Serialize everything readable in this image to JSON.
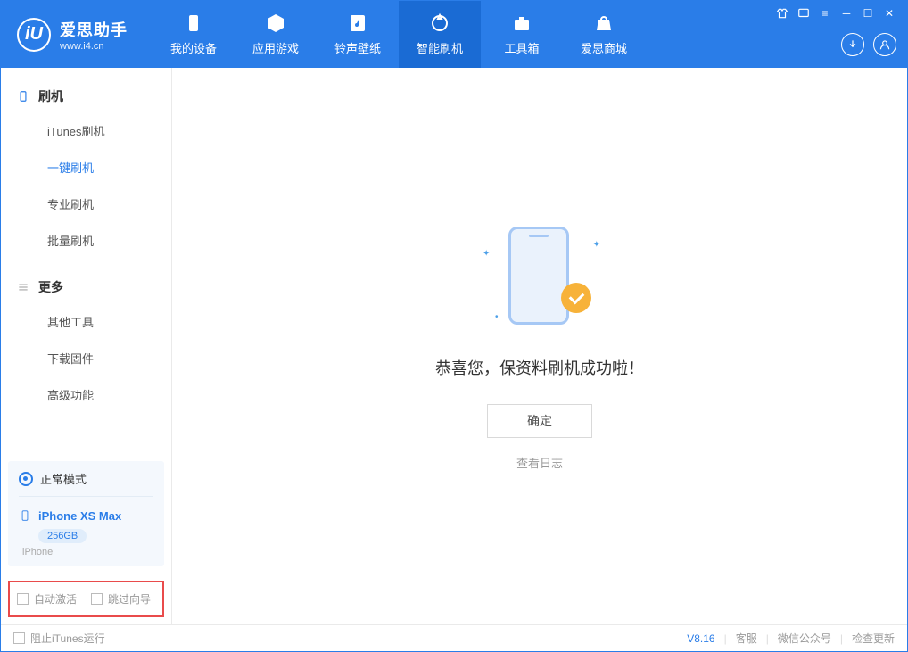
{
  "app": {
    "title": "爱思助手",
    "url": "www.i4.cn"
  },
  "nav": {
    "tabs": [
      {
        "label": "我的设备",
        "icon": "device"
      },
      {
        "label": "应用游戏",
        "icon": "cube"
      },
      {
        "label": "铃声壁纸",
        "icon": "music"
      },
      {
        "label": "智能刷机",
        "icon": "refresh",
        "active": true
      },
      {
        "label": "工具箱",
        "icon": "toolbox"
      },
      {
        "label": "爱思商城",
        "icon": "store"
      }
    ]
  },
  "sidebar": {
    "section1": {
      "title": "刷机",
      "items": [
        "iTunes刷机",
        "一键刷机",
        "专业刷机",
        "批量刷机"
      ],
      "active_index": 1
    },
    "section2": {
      "title": "更多",
      "items": [
        "其他工具",
        "下载固件",
        "高级功能"
      ]
    },
    "device": {
      "mode": "正常模式",
      "name": "iPhone XS Max",
      "storage": "256GB",
      "type": "iPhone"
    },
    "checks": {
      "auto_activate": "自动激活",
      "skip_guide": "跳过向导"
    }
  },
  "main": {
    "success_text": "恭喜您，保资料刷机成功啦！",
    "ok_button": "确定",
    "log_link": "查看日志"
  },
  "footer": {
    "block_itunes": "阻止iTunes运行",
    "version": "V8.16",
    "support": "客服",
    "wechat": "微信公众号",
    "check_update": "检查更新"
  }
}
